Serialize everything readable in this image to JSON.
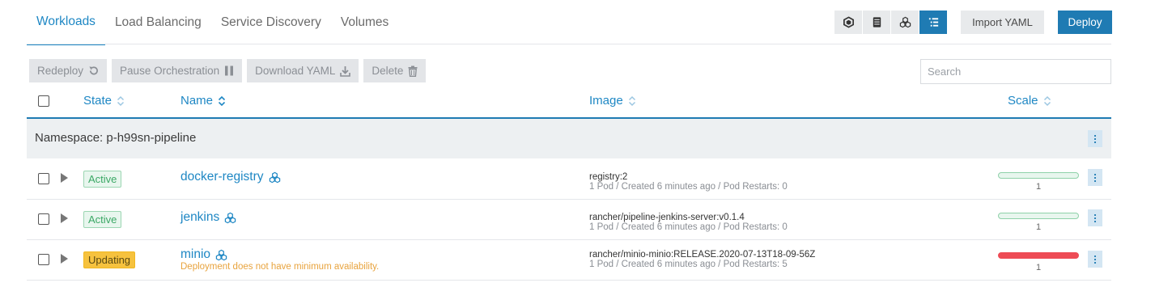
{
  "tabs": [
    {
      "label": "Workloads",
      "active": true
    },
    {
      "label": "Load Balancing",
      "active": false
    },
    {
      "label": "Service Discovery",
      "active": false
    },
    {
      "label": "Volumes",
      "active": false
    }
  ],
  "view_toggle": [
    "cube-icon",
    "server-icon",
    "cluster-icon",
    "list-icon"
  ],
  "toolbar": {
    "import_label": "Import YAML",
    "deploy_label": "Deploy"
  },
  "actions": {
    "redeploy": "Redeploy",
    "pause": "Pause Orchestration",
    "download": "Download YAML",
    "delete": "Delete"
  },
  "search": {
    "placeholder": "Search",
    "value": ""
  },
  "columns": {
    "state": "State",
    "name": "Name",
    "image": "Image",
    "scale": "Scale"
  },
  "namespace": {
    "label": "Namespace: p-h99sn-pipeline"
  },
  "rows": [
    {
      "state": "Active",
      "name": "docker-registry",
      "message": "",
      "image": "registry:2",
      "details": "1 Pod / Created 6 minutes ago / Pod Restarts: 0",
      "scale": "1"
    },
    {
      "state": "Active",
      "name": "jenkins",
      "message": "",
      "image": "rancher/pipeline-jenkins-server:v0.1.4",
      "details": "1 Pod / Created 6 minutes ago / Pod Restarts: 0",
      "scale": "1"
    },
    {
      "state": "Updating",
      "name": "minio",
      "message": "Deployment does not have minimum availability.",
      "image": "rancher/minio-minio:RELEASE.2020-07-13T18-09-56Z",
      "details": "1 Pod / Created 6 minutes ago / Pod Restarts: 5",
      "scale": "1"
    }
  ],
  "colors": {
    "accent": "#1f7bb3",
    "link": "#1e87c4",
    "active": "#3ba865",
    "updating": "#f6c23e",
    "error": "#ee4b55",
    "warning_text": "#e8a33d"
  }
}
